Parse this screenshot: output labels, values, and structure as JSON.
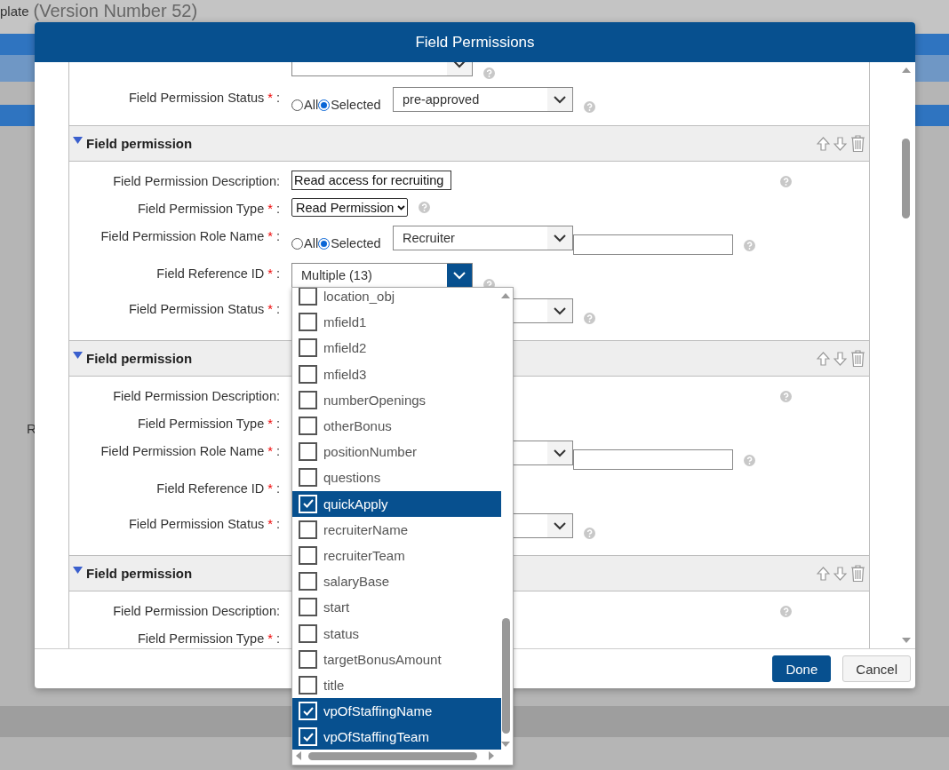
{
  "page": {
    "title_fragment": "plate",
    "version": "(Version Number 52)",
    "side_letter": "R"
  },
  "dialog": {
    "title": "Field Permissions",
    "partial_section": {
      "rows": [
        {
          "kind": "multi",
          "select": true,
          "help": true
        },
        {
          "kind": "radio-select",
          "label": "Field Permission Status",
          "required_mark": "*",
          "colon": ":",
          "options": [
            {
              "label": "All",
              "selected": false
            },
            {
              "label": "Selected",
              "selected": true
            }
          ],
          "value": "pre-approved",
          "help": true
        }
      ]
    },
    "sections": [
      {
        "title": "Field permission",
        "expanded": true,
        "rows": [
          {
            "kind": "text",
            "label": "Field Permission Description:",
            "value": "Read access for recruiting",
            "help": true
          },
          {
            "kind": "select-small",
            "label": "Field Permission Type",
            "required_mark": "*",
            "colon": ":",
            "value": "Read Permission",
            "help": true
          },
          {
            "kind": "radio-select",
            "label": "Field Permission Role Name",
            "required_mark": "*",
            "colon": ":",
            "options": [
              {
                "label": "All",
                "selected": false
              },
              {
                "label": "Selected",
                "selected": true
              }
            ],
            "value": "Recruiter",
            "extra_input": true,
            "help": true
          },
          {
            "kind": "multi",
            "label": "Field Reference ID",
            "required_mark": "*",
            "colon": ":",
            "value": "Multiple (13)",
            "open": true,
            "help": true
          },
          {
            "kind": "radio-select",
            "label": "Field Permission Status",
            "required_mark": "*",
            "colon": ":",
            "select": true,
            "help": true
          }
        ]
      },
      {
        "title": "Field permission",
        "expanded": true,
        "rows": [
          {
            "kind": "text",
            "label": "Field Permission Description:",
            "help": true
          },
          {
            "kind": "select-small",
            "label": "Field Permission Type",
            "required_mark": "*",
            "colon": ":"
          },
          {
            "kind": "radio-select",
            "label": "Field Permission Role Name",
            "required_mark": "*",
            "colon": ":",
            "select": true,
            "extra_input": true,
            "help": true
          },
          {
            "kind": "multi",
            "label": "Field Reference ID",
            "required_mark": "*",
            "colon": ":"
          },
          {
            "kind": "radio-select",
            "label": "Field Permission Status",
            "required_mark": "*",
            "colon": ":",
            "select": true,
            "help": true
          }
        ]
      },
      {
        "title": "Field permission",
        "expanded": true,
        "rows": [
          {
            "kind": "text",
            "label": "Field Permission Description:",
            "help": true
          },
          {
            "kind": "select-small",
            "label": "Field Permission Type",
            "required_mark": "*",
            "colon": ":"
          }
        ]
      }
    ],
    "buttons": [
      {
        "label": "Done",
        "kind": "primary"
      },
      {
        "label": "Cancel",
        "kind": "secondary"
      }
    ]
  },
  "dropdown": {
    "items": [
      {
        "label": "location_obj",
        "checked": false
      },
      {
        "label": "mfield1",
        "checked": false
      },
      {
        "label": "mfield2",
        "checked": false
      },
      {
        "label": "mfield3",
        "checked": false
      },
      {
        "label": "numberOpenings",
        "checked": false
      },
      {
        "label": "otherBonus",
        "checked": false
      },
      {
        "label": "positionNumber",
        "checked": false
      },
      {
        "label": "questions",
        "checked": false
      },
      {
        "label": "quickApply",
        "checked": true
      },
      {
        "label": "recruiterName",
        "checked": false
      },
      {
        "label": "recruiterTeam",
        "checked": false
      },
      {
        "label": "salaryBase",
        "checked": false
      },
      {
        "label": "start",
        "checked": false
      },
      {
        "label": "status",
        "checked": false
      },
      {
        "label": "targetBonusAmount",
        "checked": false
      },
      {
        "label": "title",
        "checked": false
      },
      {
        "label": "vpOfStaffingName",
        "checked": true
      },
      {
        "label": "vpOfStaffingTeam",
        "checked": true
      }
    ]
  }
}
